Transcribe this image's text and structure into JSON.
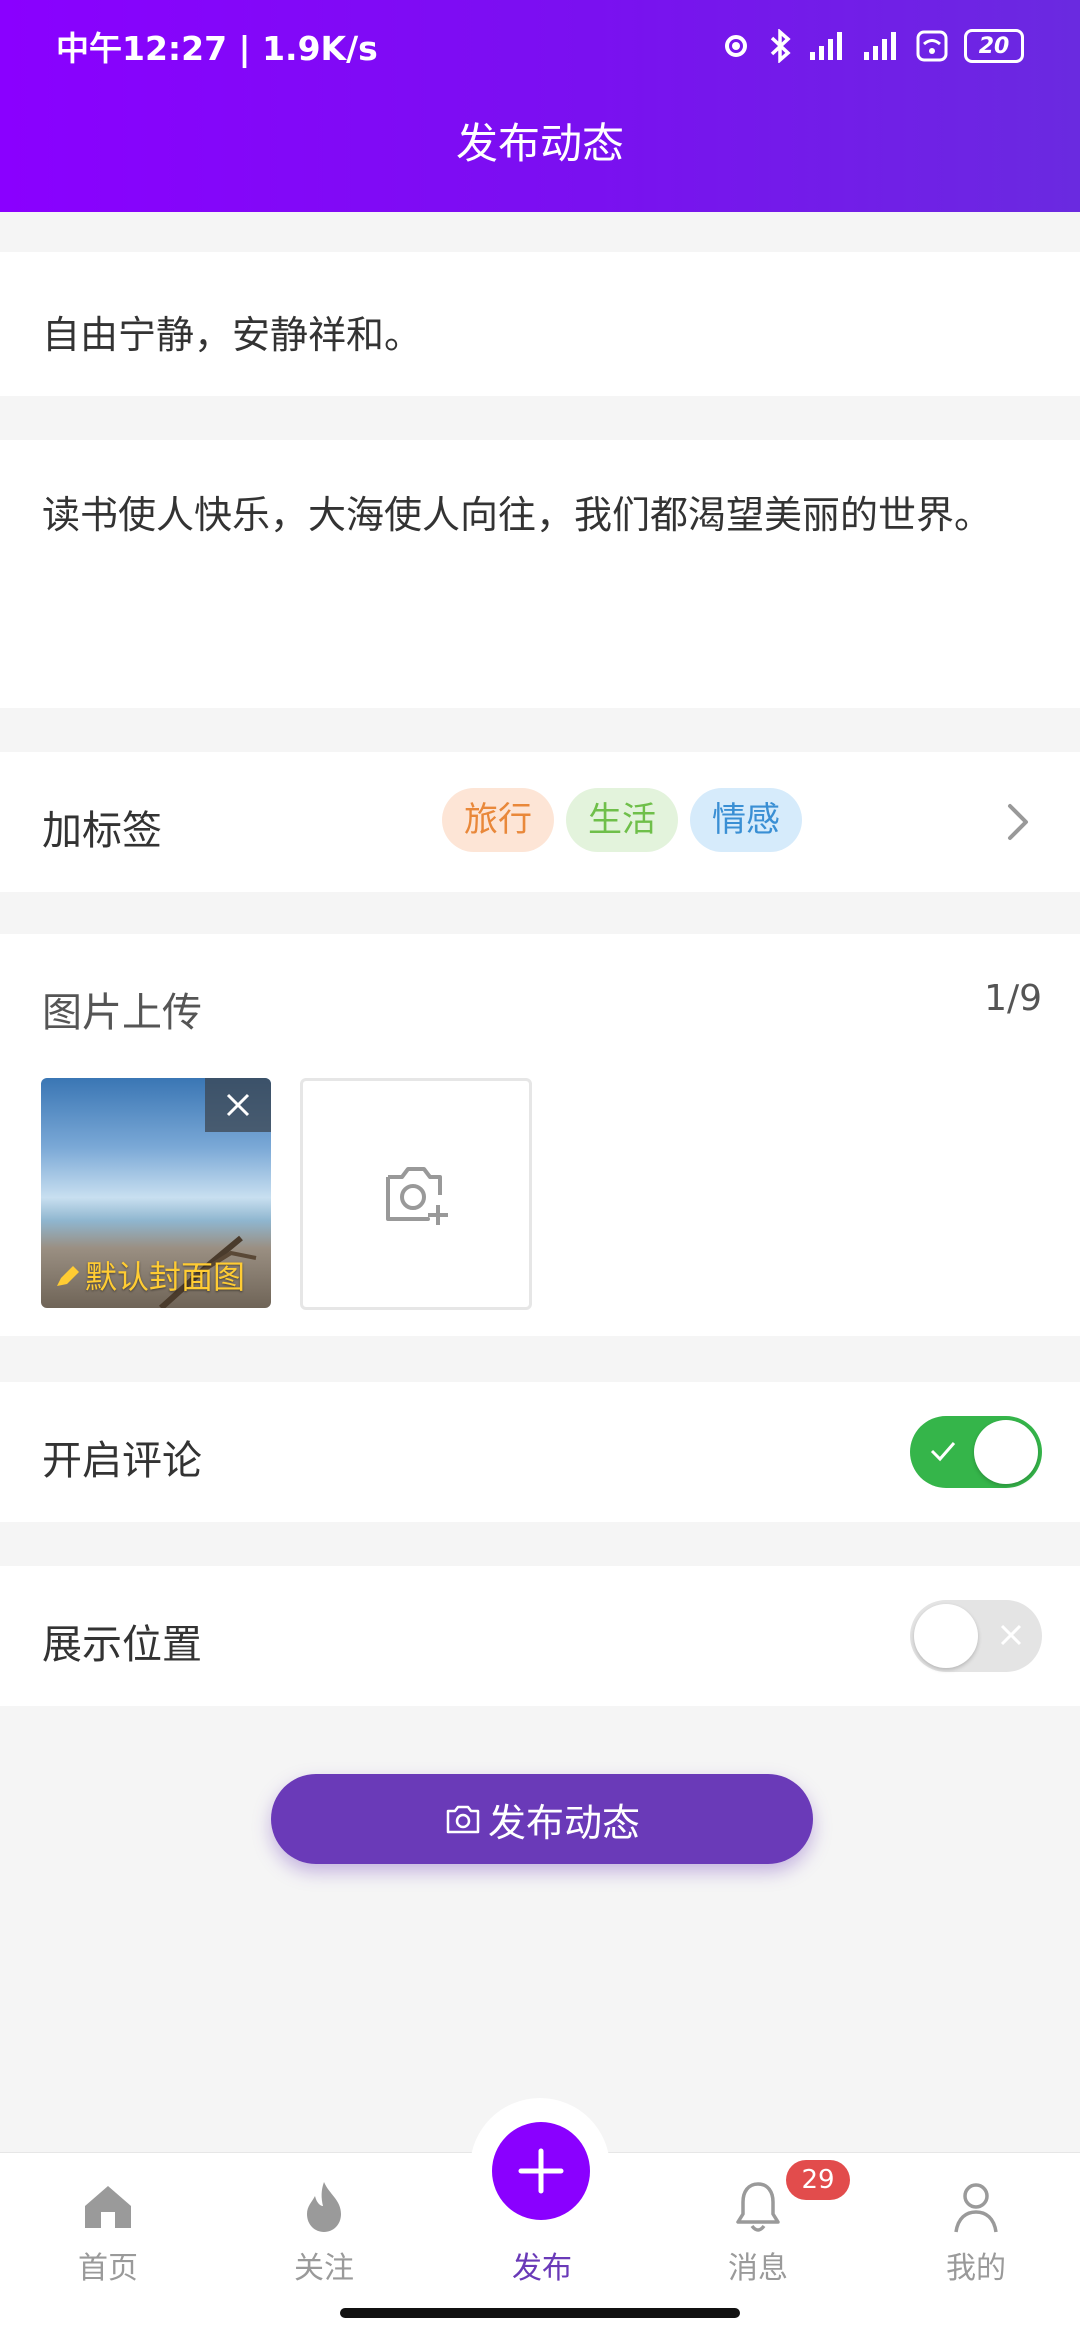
{
  "status_bar": {
    "time_speed": "中午12:27 | 1.9K/s",
    "battery": "20"
  },
  "header": {
    "title": "发布动态"
  },
  "post": {
    "title_text": "自由宁静，安静祥和。",
    "body_text": "读书使人快乐，大海使人向往，我们都渴望美丽的世界。"
  },
  "tags_section": {
    "label": "加标签",
    "tags": [
      "旅行",
      "生活",
      "情感"
    ]
  },
  "upload_section": {
    "label": "图片上传",
    "count": "1/9",
    "cover_label": "默认封面图"
  },
  "comment_row": {
    "label": "开启评论",
    "enabled": true
  },
  "location_row": {
    "label": "展示位置",
    "enabled": false
  },
  "publish_button": {
    "label": "发布动态"
  },
  "tabbar": {
    "items": [
      {
        "label": "首页",
        "icon": "home-icon"
      },
      {
        "label": "关注",
        "icon": "flame-icon"
      },
      {
        "label": "发布",
        "icon": "plus-icon"
      },
      {
        "label": "消息",
        "icon": "bell-icon"
      },
      {
        "label": "我的",
        "icon": "user-icon"
      }
    ],
    "message_badge": "29"
  },
  "colors": {
    "header_start": "#8a00ff",
    "accent": "#6a3ab8",
    "toggle_on": "#35b54a",
    "badge": "#e24c4c"
  }
}
